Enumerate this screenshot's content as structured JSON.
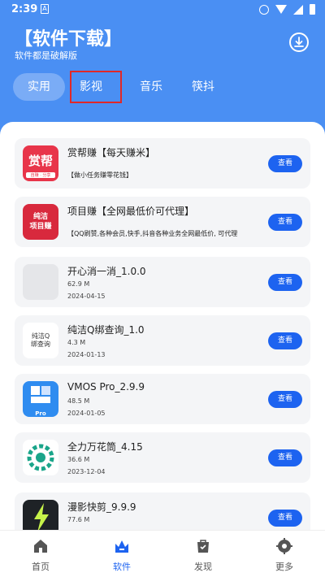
{
  "status_bar": {
    "time": "2:39",
    "notification_glyph": "A"
  },
  "header": {
    "title": "【软件下载】",
    "subtitle": "软件都是破解版"
  },
  "tabs": [
    {
      "label": "实用"
    },
    {
      "label": "影视"
    },
    {
      "label": "音乐"
    },
    {
      "label": "筷抖"
    }
  ],
  "apps": [
    {
      "name": "赏帮赚【每天赚米】",
      "description": "【做小任务赚零花钱】",
      "icon_text": "赏帮",
      "icon_sub": "自赚 · 分享",
      "button": "查看"
    },
    {
      "name": "项目赚【全网最低价可代理】",
      "description": "【QQ刷赞,各种会员,快手,抖音各种业务全网最低价, 可代理",
      "icon_text": "纯洁\n项目赚",
      "button": "查看"
    },
    {
      "name": "开心消一消_1.0.0",
      "size": "62.9 M",
      "date": "2024-04-15",
      "button": "查看"
    },
    {
      "name": "纯洁Q绑查询_1.0",
      "size": "4.3 M",
      "date": "2024-01-13",
      "icon_text": "纯洁Q\n绑查询",
      "button": "查看"
    },
    {
      "name": "VMOS Pro_2.9.9",
      "size": "48.5 M",
      "date": "2024-01-05",
      "icon_text": "Pro",
      "button": "查看"
    },
    {
      "name": "全力万花筒_4.15",
      "size": "36.6 M",
      "date": "2023-12-04",
      "button": "查看"
    },
    {
      "name": "漫影快剪_9.9.9",
      "size": "77.6 M",
      "button": "查看"
    }
  ],
  "bottom_nav": [
    {
      "label": "首页",
      "icon": "home-icon"
    },
    {
      "label": "软件",
      "icon": "software-icon"
    },
    {
      "label": "发现",
      "icon": "discover-icon"
    },
    {
      "label": "更多",
      "icon": "more-icon"
    }
  ],
  "colors": {
    "primary": "#4a8ff3",
    "button": "#1d63f0",
    "highlight_border": "#e02828"
  }
}
